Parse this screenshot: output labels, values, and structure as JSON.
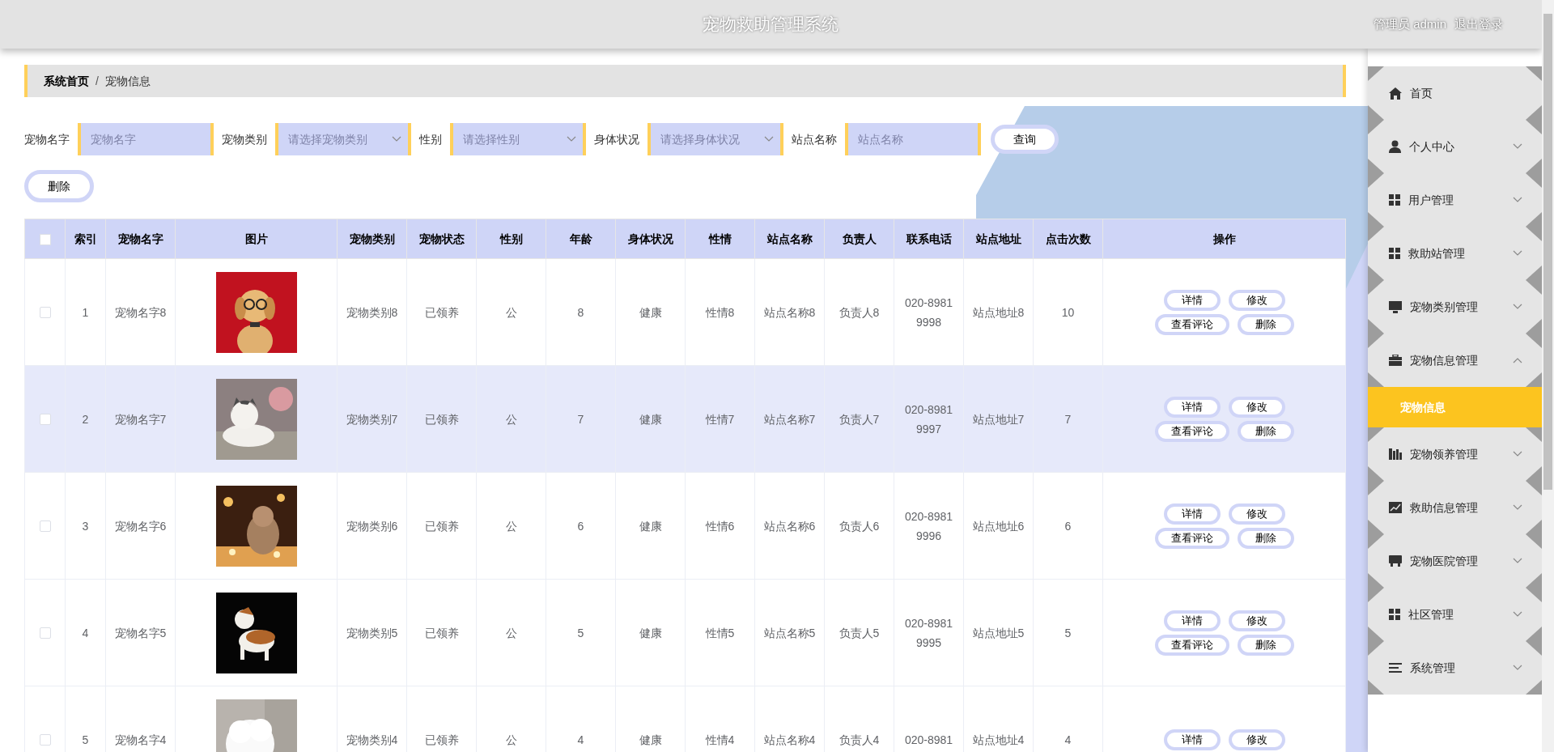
{
  "header": {
    "title": "宠物救助管理系统",
    "user": "管理员 admin",
    "logout": "退出登录"
  },
  "breadcrumb": {
    "items": [
      "系统首页",
      "宠物信息"
    ],
    "separator": "/"
  },
  "search": {
    "fields": [
      {
        "label": "宠物名字",
        "kind": "input",
        "placeholder": "宠物名字"
      },
      {
        "label": "宠物类别",
        "kind": "select",
        "placeholder": "请选择宠物类别"
      },
      {
        "label": "性别",
        "kind": "select",
        "placeholder": "请选择性别"
      },
      {
        "label": "身体状况",
        "kind": "select",
        "placeholder": "请选择身体状况"
      },
      {
        "label": "站点名称",
        "kind": "input",
        "placeholder": "站点名称"
      }
    ],
    "button": "查询"
  },
  "delete_button": "删除",
  "table": {
    "columns": [
      "索引",
      "宠物名字",
      "图片",
      "宠物类别",
      "宠物状态",
      "性别",
      "年龄",
      "身体状况",
      "性情",
      "站点名称",
      "负责人",
      "联系电话",
      "站点地址",
      "点击次数",
      "操作"
    ],
    "header_checked": false,
    "rows": [
      {
        "checked": false,
        "highlighted": false,
        "cells": [
          "1",
          "宠物名字8",
          {
            "kind": "picture"
          },
          "宠物类别8",
          "已领养",
          "公",
          "8",
          "健康",
          "性情8",
          "站点名称8",
          "负责人8",
          "020-8981 9998",
          "站点地址8",
          "10"
        ],
        "actions": [
          "详情",
          "修改",
          "查看评论",
          "删除"
        ]
      },
      {
        "checked": false,
        "highlighted": true,
        "cells": [
          "2",
          "宠物名字7",
          {
            "kind": "picture"
          },
          "宠物类别7",
          "已领养",
          "公",
          "7",
          "健康",
          "性情7",
          "站点名称7",
          "负责人7",
          "020-8981 9997",
          "站点地址7",
          "7"
        ],
        "actions": [
          "详情",
          "修改",
          "查看评论",
          "删除"
        ]
      },
      {
        "checked": false,
        "highlighted": false,
        "cells": [
          "3",
          "宠物名字6",
          {
            "kind": "picture"
          },
          "宠物类别6",
          "已领养",
          "公",
          "6",
          "健康",
          "性情6",
          "站点名称6",
          "负责人6",
          "020-8981 9996",
          "站点地址6",
          "6"
        ],
        "actions": [
          "详情",
          "修改",
          "查看评论",
          "删除"
        ]
      },
      {
        "checked": false,
        "highlighted": false,
        "cells": [
          "4",
          "宠物名字5",
          {
            "kind": "picture"
          },
          "宠物类别5",
          "已领养",
          "公",
          "5",
          "健康",
          "性情5",
          "站点名称5",
          "负责人5",
          "020-8981 9995",
          "站点地址5",
          "5"
        ],
        "actions": [
          "详情",
          "修改",
          "查看评论",
          "删除"
        ]
      },
      {
        "checked": false,
        "highlighted": false,
        "cells": [
          "5",
          "宠物名字4",
          {
            "kind": "picture"
          },
          "宠物类别4",
          "已领养",
          "公",
          "4",
          "健康",
          "性情4",
          "站点名称4",
          "负责人4",
          "020-8981",
          "站点地址4",
          "4"
        ],
        "actions": [
          "详情",
          "修改"
        ]
      }
    ]
  },
  "sidebar": {
    "items": [
      {
        "label": "首页",
        "kind": "link"
      },
      {
        "label": "个人中心",
        "kind": "menu",
        "expanded": false
      },
      {
        "label": "用户管理",
        "kind": "menu",
        "expanded": false
      },
      {
        "label": "救助站管理",
        "kind": "menu",
        "expanded": false
      },
      {
        "label": "宠物类别管理",
        "kind": "menu",
        "expanded": false
      },
      {
        "label": "宠物信息管理",
        "kind": "menu",
        "expanded": true,
        "children": [
          {
            "label": "宠物信息",
            "selected": true
          }
        ]
      },
      {
        "label": "宠物领养管理",
        "kind": "menu",
        "expanded": false
      },
      {
        "label": "救助信息管理",
        "kind": "menu",
        "expanded": false
      },
      {
        "label": "宠物医院管理",
        "kind": "menu",
        "expanded": false
      },
      {
        "label": "社区管理",
        "kind": "menu",
        "expanded": false
      },
      {
        "label": "系统管理",
        "kind": "menu",
        "expanded": false
      }
    ]
  }
}
